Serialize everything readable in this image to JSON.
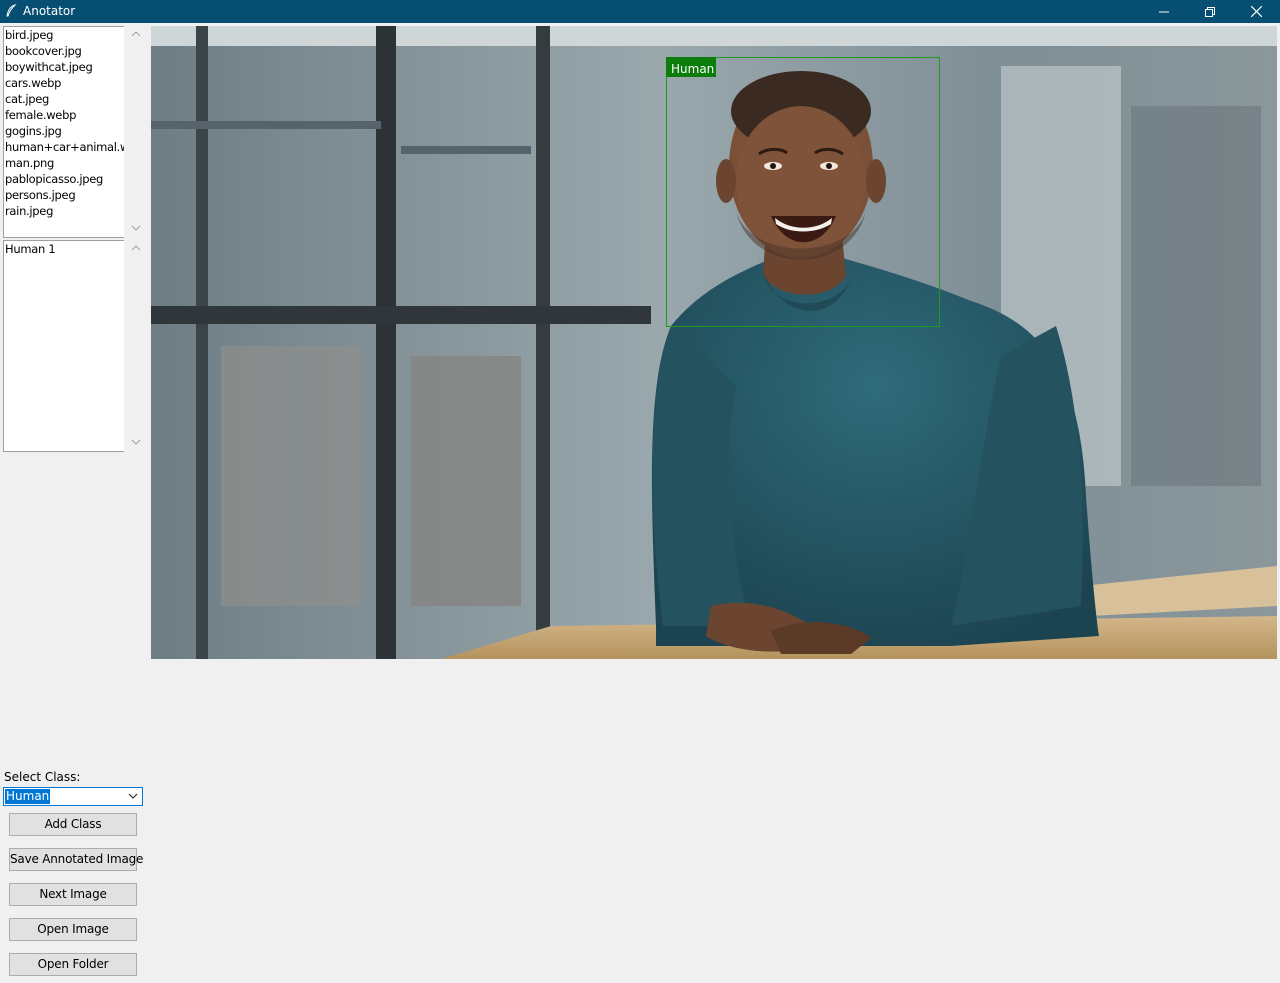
{
  "window": {
    "title": "Anotator",
    "minimize_icon": "minimize-icon",
    "maximize_icon": "restore-icon",
    "close_icon": "close-icon"
  },
  "file_list": {
    "items": [
      "bird.jpeg",
      "bookcover.jpg",
      "boywithcat.jpeg",
      "cars.webp",
      "cat.jpeg",
      "female.webp",
      "gogins.jpg",
      "human+car+animal.webp",
      "man.png",
      "pablopicasso.jpeg",
      "persons.jpeg",
      "rain.jpeg"
    ]
  },
  "annotation_list": {
    "items": [
      "Human 1"
    ]
  },
  "canvas": {
    "box_label": "Human",
    "box_color": "#0a7d0a"
  },
  "controls": {
    "select_class_label": "Select Class:",
    "selected_class": "Human",
    "add_class": "Add Class",
    "save_annotated": "Save Annotated Image",
    "next_image": "Next Image",
    "open_image": "Open Image",
    "open_folder": "Open Folder"
  },
  "colors": {
    "titlebar": "#064e72",
    "accent": "#0078d7"
  }
}
